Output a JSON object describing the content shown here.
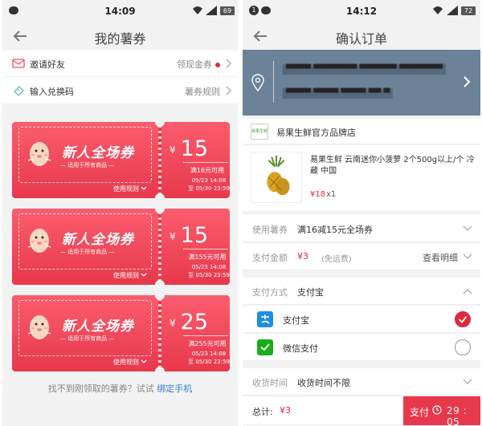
{
  "left": {
    "status": {
      "time": "14:09",
      "battery": "69"
    },
    "title": "我的薯券",
    "invite": {
      "label": "邀请好友",
      "right": "领现金券"
    },
    "redeem": {
      "label": "输入兑换码",
      "right": "薯券规则"
    },
    "coupons": [
      {
        "title": "新人全场券",
        "subtitle": "适用于所有商品",
        "rule": "使用规则",
        "currency": "¥",
        "amount": "15",
        "condition": "满16元可用",
        "start": "05/23 14:08",
        "end": "至 05/30 23:59"
      },
      {
        "title": "新人全场券",
        "subtitle": "适用于所有商品",
        "rule": "使用规则",
        "currency": "¥",
        "amount": "15",
        "condition": "满155元可用",
        "start": "05/23 14:08",
        "end": "至 05/30 23:59"
      },
      {
        "title": "新人全场券",
        "subtitle": "适用于所有商品",
        "rule": "使用规则",
        "currency": "¥",
        "amount": "25",
        "condition": "满255元可用",
        "start": "05/23 14:08",
        "end": "至 05/30 23:59"
      }
    ],
    "footer": {
      "text": "找不到刚领取的薯券？试试",
      "link": "绑定手机"
    }
  },
  "right": {
    "status": {
      "time": "14:12",
      "notif": "1",
      "battery": "72"
    },
    "title": "确认订单",
    "address": {
      "line1": "▀▀▀▀ ▀▀▀▀▀▀▀ ▀▀▀▀▀▀ ▀▀▀▀▀▀▀",
      "line2": "▀▀▀▀ ▀▀▀▀ ▀▀▀▀ ▀▀ ▀"
    },
    "shop": {
      "logo": "易果生鲜",
      "name": "易果生鲜官方品牌店"
    },
    "item": {
      "desc": "易果生鲜 云南迷你小菠萝 2个500g以上/个 冷藏 中国",
      "price": "¥18",
      "qty": "x1"
    },
    "coupon_row": {
      "key": "使用薯券",
      "value": "满16减15元全场券"
    },
    "amount_row": {
      "key": "支付金额",
      "value": "¥3",
      "note": "(免运费)",
      "detail": "查看明细"
    },
    "method_row": {
      "key": "支付方式",
      "value": "支付宝"
    },
    "payments": [
      {
        "name": "支付宝",
        "icon": "alipay-icon",
        "selected": true
      },
      {
        "name": "微信支付",
        "icon": "wechat-pay-icon",
        "selected": false
      }
    ],
    "delivery_row": {
      "key": "收货时间",
      "value": "收货时间不限"
    },
    "total": {
      "label": "总计:",
      "value": "¥3"
    },
    "pay_button": {
      "label": "支付",
      "countdown": "29 : 05"
    }
  },
  "colors": {
    "accent": "#e8384c",
    "address_bg": "#6b8299",
    "link": "#3a7bd5"
  }
}
